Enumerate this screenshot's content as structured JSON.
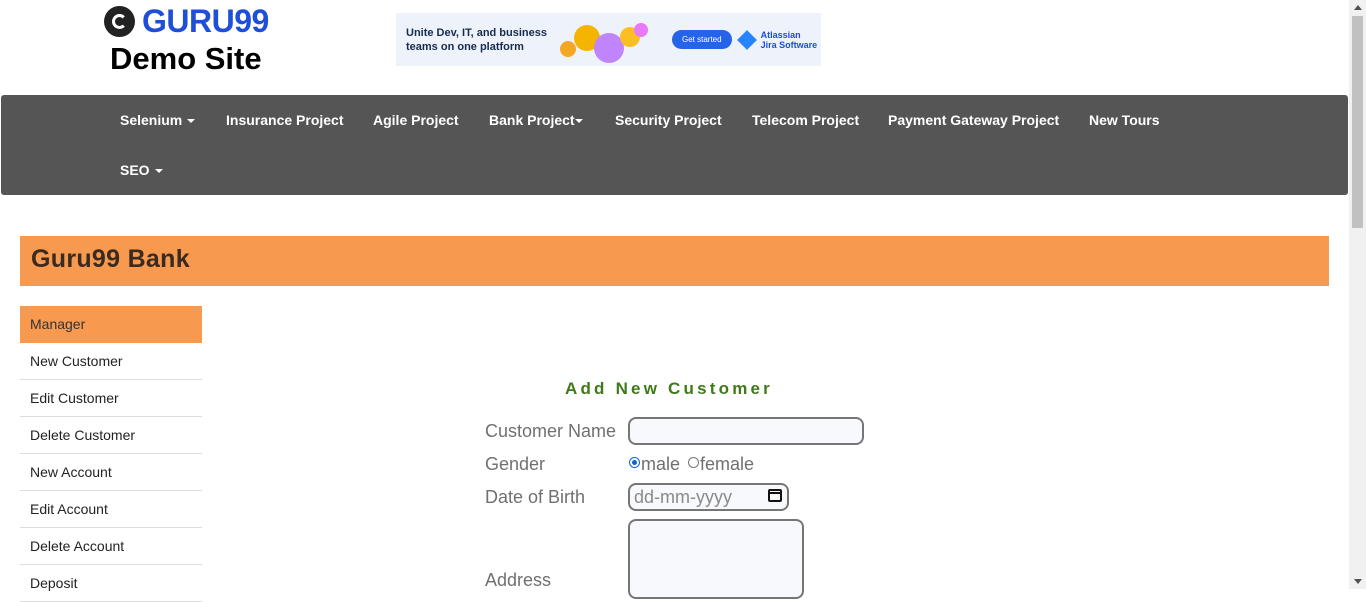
{
  "header": {
    "logo_text": "GURU99",
    "site_title": "Demo Site"
  },
  "ad": {
    "headline": "Unite Dev, IT, and business teams on one platform",
    "cta": "Get started",
    "brand_line1": "Atlassian",
    "brand_line2": "Jira Software"
  },
  "nav": {
    "items": [
      {
        "label": "Selenium",
        "dropdown": true
      },
      {
        "label": "Insurance Project",
        "dropdown": false
      },
      {
        "label": "Agile Project",
        "dropdown": false
      },
      {
        "label": "Bank Project",
        "dropdown": true
      },
      {
        "label": "Security Project",
        "dropdown": false
      },
      {
        "label": "Telecom Project",
        "dropdown": false
      },
      {
        "label": "Payment Gateway Project",
        "dropdown": false
      },
      {
        "label": "New Tours",
        "dropdown": false
      },
      {
        "label": "SEO",
        "dropdown": true
      }
    ]
  },
  "bank": {
    "title": "Guru99 Bank"
  },
  "sidebar": {
    "items": [
      {
        "label": "Manager",
        "active": true
      },
      {
        "label": "New Customer",
        "active": false
      },
      {
        "label": "Edit Customer",
        "active": false
      },
      {
        "label": "Delete Customer",
        "active": false
      },
      {
        "label": "New Account",
        "active": false
      },
      {
        "label": "Edit Account",
        "active": false
      },
      {
        "label": "Delete Account",
        "active": false
      },
      {
        "label": "Deposit",
        "active": false
      }
    ]
  },
  "form": {
    "title": "Add New Customer",
    "customer_name_label": "Customer Name",
    "customer_name_value": "",
    "gender_label": "Gender",
    "gender_options": [
      "male",
      "female"
    ],
    "gender_selected": "male",
    "dob_label": "Date of Birth",
    "dob_placeholder": "dd-mm-yyyy",
    "address_label": "Address",
    "address_value": ""
  },
  "colors": {
    "nav_bg": "#555555",
    "accent_orange": "#f79a50",
    "form_title_green": "#3f7a18",
    "logo_blue": "#1f4fd8"
  }
}
